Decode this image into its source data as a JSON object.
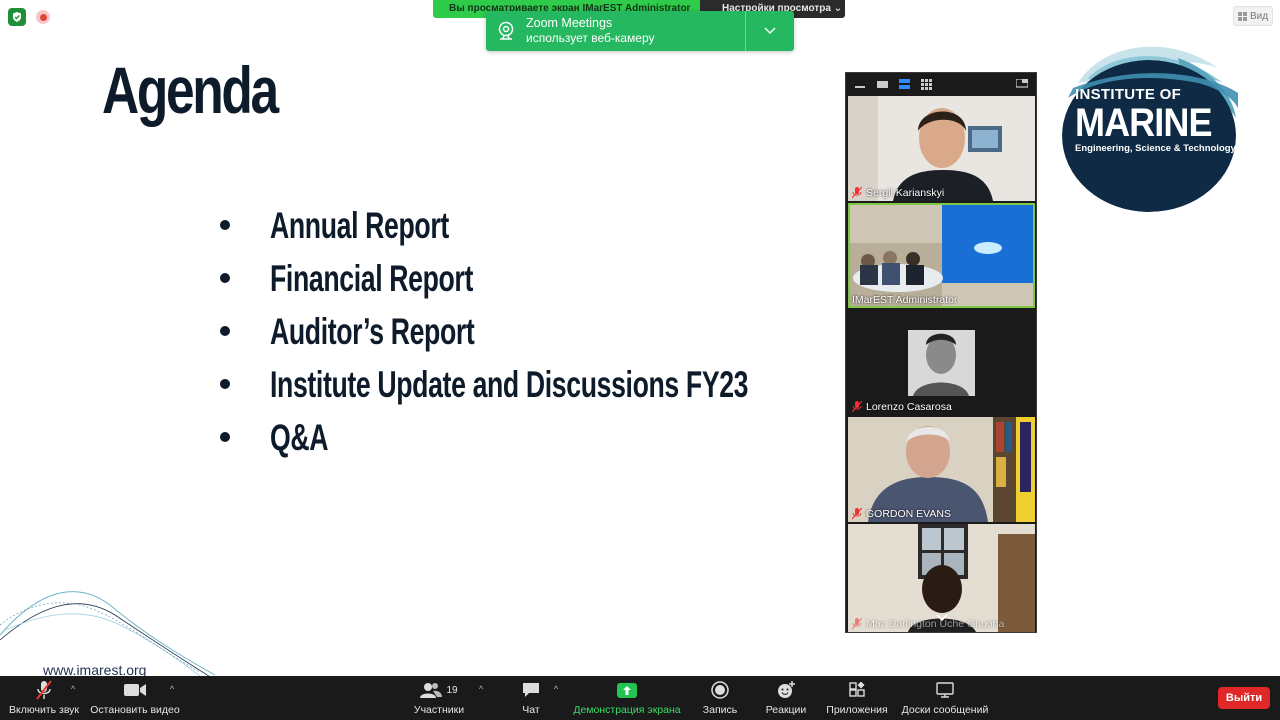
{
  "banner": {
    "left_text": "Вы просматриваете экран IMarEST Administrator",
    "right_text": "Настройки просмотра"
  },
  "toast": {
    "app": "Zoom Meetings",
    "message": "использует веб-камеру"
  },
  "view_button": {
    "label": "Вид"
  },
  "slide": {
    "title": "Agenda",
    "items": [
      "Annual Report",
      "Financial Report",
      "Auditor’s Report",
      "Institute Update and Discussions FY23",
      "Q&A"
    ],
    "website": "www.imarest.org",
    "logo": {
      "line1": "INSTITUTE OF",
      "line2": "MARINE",
      "line3": "Engineering, Science & Technology"
    }
  },
  "gallery": {
    "participants": [
      {
        "name": "Sergii Karianskyi",
        "muted": true
      },
      {
        "name": "IMarEST Administrator",
        "muted": false,
        "active": true
      },
      {
        "name": "Lorenzo Casarosa",
        "muted": true
      },
      {
        "name": "GORDON EVANS",
        "muted": true
      },
      {
        "name": "Mac Darlington Uche Onuoha",
        "muted": true
      }
    ]
  },
  "toolbar": {
    "unmute": "Включить звук",
    "stop_video": "Остановить видео",
    "participants": "Участники",
    "participants_count": "19",
    "chat": "Чат",
    "share_screen": "Демонстрация экрана",
    "record": "Запись",
    "reactions": "Реакции",
    "apps": "Приложения",
    "whiteboards": "Доски сообщений",
    "leave": "Выйти"
  },
  "colors": {
    "accent_green": "#2ecc4a",
    "toast_green": "#25b861",
    "slide_text": "#0d1b2a",
    "logo_blue": "#0f2a44",
    "leave_red": "#e02828"
  }
}
